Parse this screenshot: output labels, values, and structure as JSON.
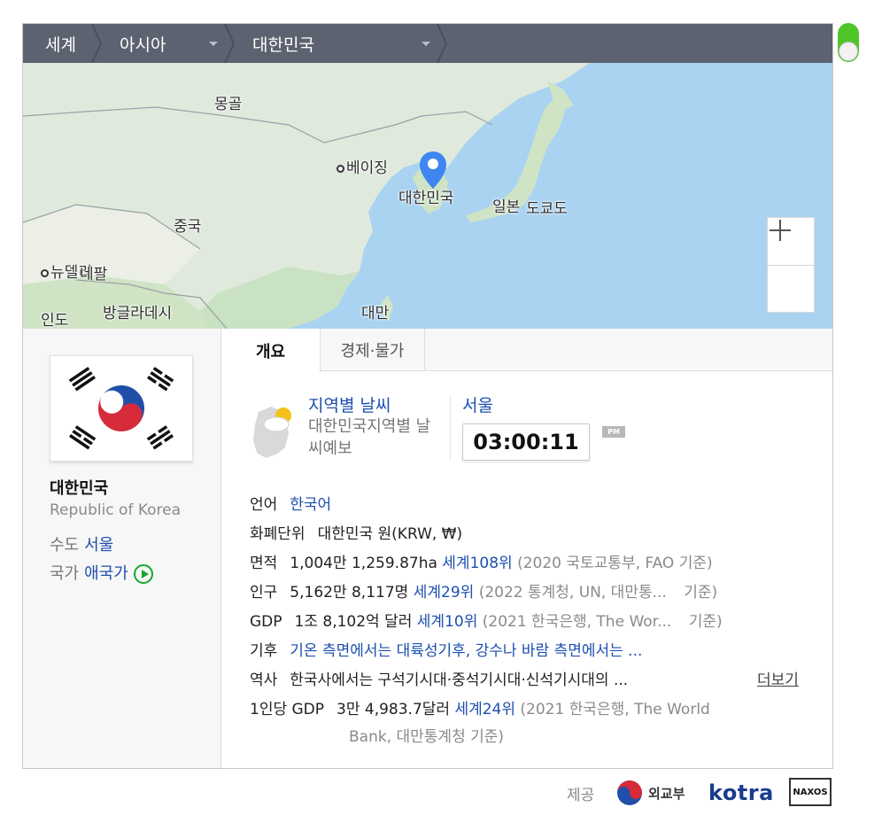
{
  "breadcrumb": {
    "world": "세계",
    "region": "아시아",
    "country": "대한민국"
  },
  "map": {
    "labels": {
      "mongolia": "몽골",
      "beijing": "베이징",
      "korea": "대한민국",
      "japan": "일본",
      "tokyo": "도쿄도",
      "china": "중국",
      "newdelhi": "뉴델리",
      "nepal": "네팔",
      "india": "인도",
      "bangladesh": "방글라데시",
      "taiwan": "대만"
    }
  },
  "country": {
    "name": "대한민국",
    "name_en": "Republic of Korea",
    "capital_label": "수도",
    "capital": "서울",
    "anthem_label": "국가",
    "anthem": "애국가"
  },
  "tabs": [
    {
      "label": "개요",
      "active": true
    },
    {
      "label": "경제·물가",
      "active": false
    }
  ],
  "weather": {
    "title": "지역별 날씨",
    "subtitle": "대한민국지역별 날씨예보",
    "city": "서울",
    "time": "03:00:11",
    "ampm": "PM"
  },
  "info": {
    "language": {
      "label": "언어",
      "value": "한국어"
    },
    "currency": {
      "label": "화폐단위",
      "value": "대한민국 원(KRW, ₩)"
    },
    "area": {
      "label": "면적",
      "value": "1,004만 1,259.87ha",
      "rank": "세계108위",
      "source": "(2020 국토교통부, FAO 기준)"
    },
    "population": {
      "label": "인구",
      "value": "5,162만 8,117명",
      "rank": "세계29위",
      "source": "(2022 통계청, UN, 대만통...",
      "source_end": "기준)"
    },
    "gdp": {
      "label": "GDP",
      "value": "1조 8,102억 달러",
      "rank": "세계10위",
      "source": "(2021 한국은행, The Wor...",
      "source_end": "기준)"
    },
    "climate": {
      "label": "기후",
      "value": "기온 측면에서는 대륙성기후, 강수나 바람 측면에서는 ..."
    },
    "history": {
      "label": "역사",
      "value": "한국사에서는 구석기시대·중석기시대·신석기시대의 ...",
      "more": "더보기"
    },
    "gdp_per_capita": {
      "label": "1인당 GDP",
      "value": "3만 4,983.7달러",
      "rank": "세계24위",
      "source1": "(2021 한국은행, The World",
      "source2": "Bank, 대만통계청 기준)"
    }
  },
  "footer": {
    "provided_label": "제공",
    "mofa": "외교부",
    "kotra": "kotra",
    "naxos": "NAXOS"
  },
  "colors": {
    "link": "#1d4fb0",
    "breadcrumb_bg": "#5d6270",
    "toggle": "#4fc52a",
    "sea": "#a9d3f1",
    "land": "#dfeadd"
  }
}
